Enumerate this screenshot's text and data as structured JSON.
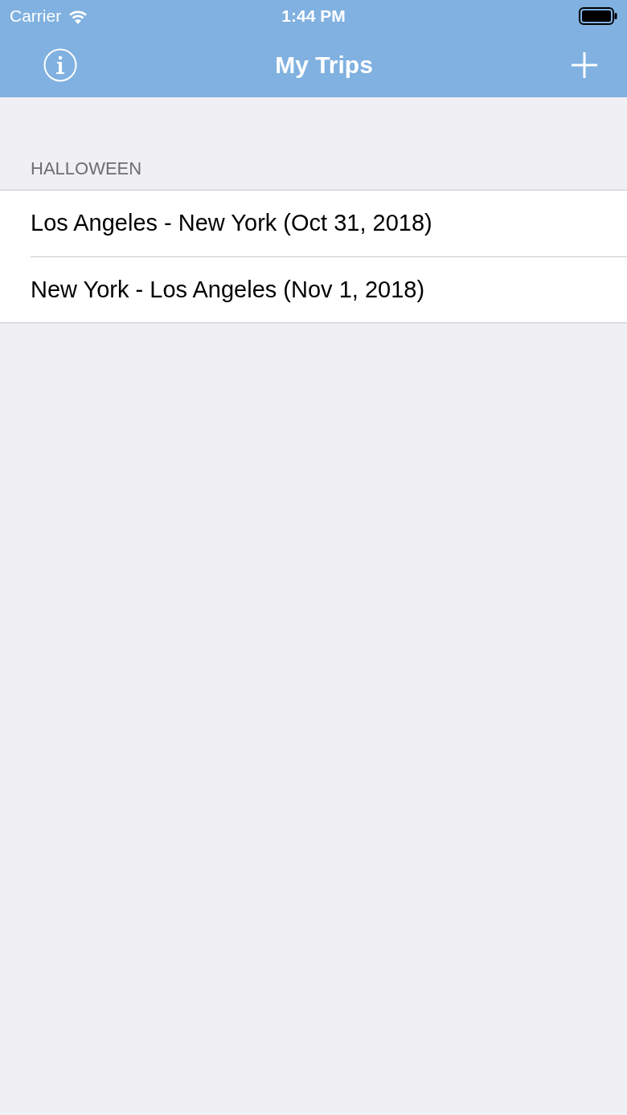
{
  "status_bar": {
    "carrier": "Carrier",
    "time": "1:44 PM"
  },
  "nav_bar": {
    "title": "My Trips"
  },
  "sections": [
    {
      "header": "HALLOWEEN",
      "rows": [
        {
          "text": "Los Angeles - New York (Oct 31, 2018)"
        },
        {
          "text": "New York - Los Angeles (Nov 1, 2018)"
        }
      ]
    }
  ]
}
